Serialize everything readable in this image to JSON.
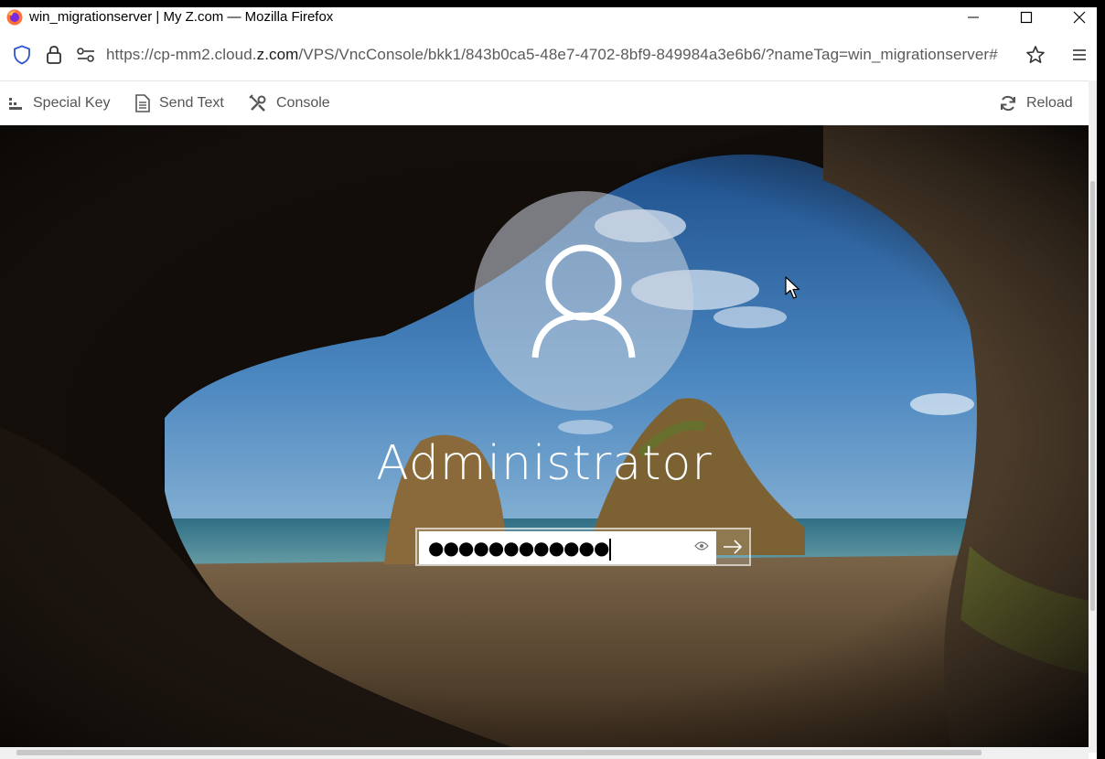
{
  "browser": {
    "window_title": "win_migrationserver | My Z.com — Mozilla Firefox",
    "url_prefix": "https://cp-mm2.cloud.",
    "url_domain": "z.com",
    "url_suffix": "/VPS/VncConsole/bkk1/843b0ca5-48e7-4702-8bf9-849984a3e6b6/?nameTag=win_migrationserver#",
    "icons": [
      "firefox-icon",
      "shield-icon",
      "lock-icon",
      "permissions-icon",
      "bookmark-star-icon",
      "menu-icon",
      "minimize-icon",
      "maximize-icon",
      "close-icon"
    ]
  },
  "toolbar": {
    "special_key": "Special Key",
    "send_text": "Send Text",
    "console": "Console",
    "reload": "Reload"
  },
  "login": {
    "username": "Administrator",
    "password_masked": "●●●●●●●●●●●●",
    "accent": "#ffffff"
  }
}
